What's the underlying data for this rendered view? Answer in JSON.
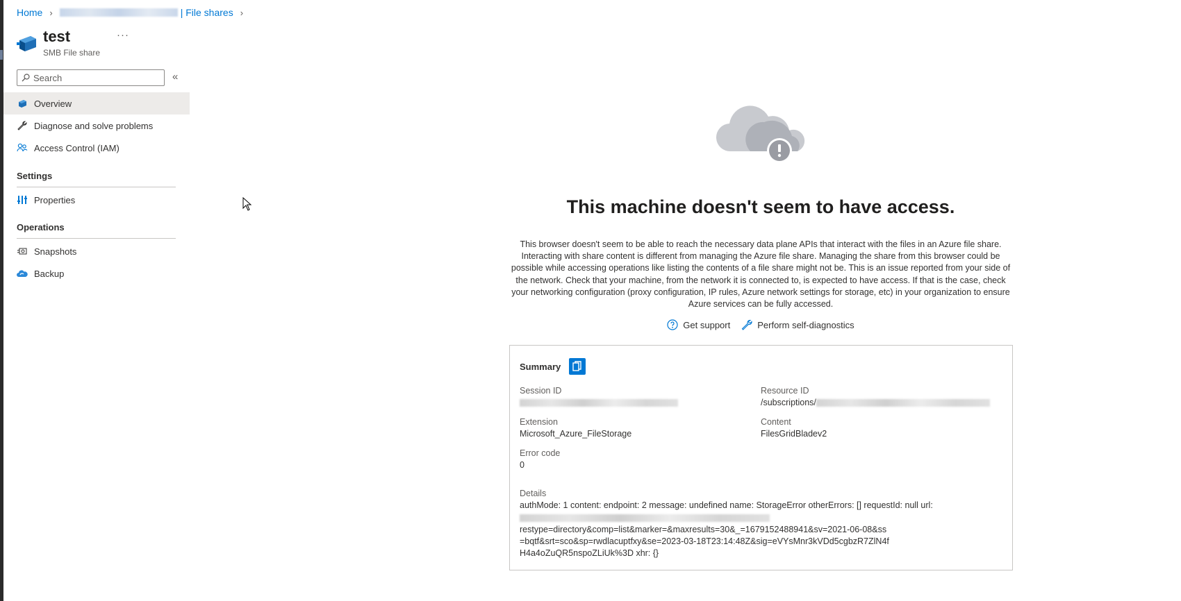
{
  "breadcrumb": {
    "home": "Home",
    "file_shares": "| File shares"
  },
  "resource": {
    "title": "test",
    "subtitle": "SMB File share",
    "more": "···"
  },
  "search": {
    "placeholder": "Search"
  },
  "collapse_glyph": "«",
  "nav": {
    "overview": "Overview",
    "diagnose": "Diagnose and solve problems",
    "access_control": "Access Control (IAM)",
    "settings_heading": "Settings",
    "properties": "Properties",
    "operations_heading": "Operations",
    "snapshots": "Snapshots",
    "backup": "Backup"
  },
  "error": {
    "title": "This machine doesn't seem to have access.",
    "description": "This browser doesn't seem to be able to reach the necessary data plane APIs that interact with the files in an Azure file share. Interacting with share content is different from managing the Azure file share. Managing the share from this browser could be possible while accessing operations like listing the contents of a file share might not be. This is an issue reported from your side of the network. Check that your machine, from the network it is connected to, is expected to have access. If that is the case, check your networking configuration (proxy configuration, IP rules, Azure network settings for storage, etc) in your organization to ensure Azure services can be fully accessed.",
    "get_support": "Get support",
    "self_diagnostics": "Perform self-diagnostics"
  },
  "summary": {
    "heading": "Summary",
    "session_id_label": "Session ID",
    "resource_id_label": "Resource ID",
    "resource_id_prefix": "/subscriptions/",
    "extension_label": "Extension",
    "extension_value": "Microsoft_Azure_FileStorage",
    "content_label": "Content",
    "content_value": "FilesGridBladev2",
    "error_code_label": "Error code",
    "error_code_value": "0",
    "details_label": "Details",
    "details_line1": "authMode: 1 content: endpoint: 2 message: undefined name: StorageError otherErrors: [] requestId: null url:",
    "details_line3": "restype=directory&comp=list&marker=&maxresults=30&_=1679152488941&sv=2021-06-08&ss=bqtf&srt=sco&sp=rwdlacuptfxy&se=2023-03-18T23:14:48Z&sig=eVYsMnr3kVDd5cgbzR7ZlN4fH4a4oZuQR5nspoZLiUk%3D xhr: {}"
  },
  "colors": {
    "accent": "#0078d4",
    "active_nav": "#edebe9",
    "cloud": "#b3b6bd"
  }
}
